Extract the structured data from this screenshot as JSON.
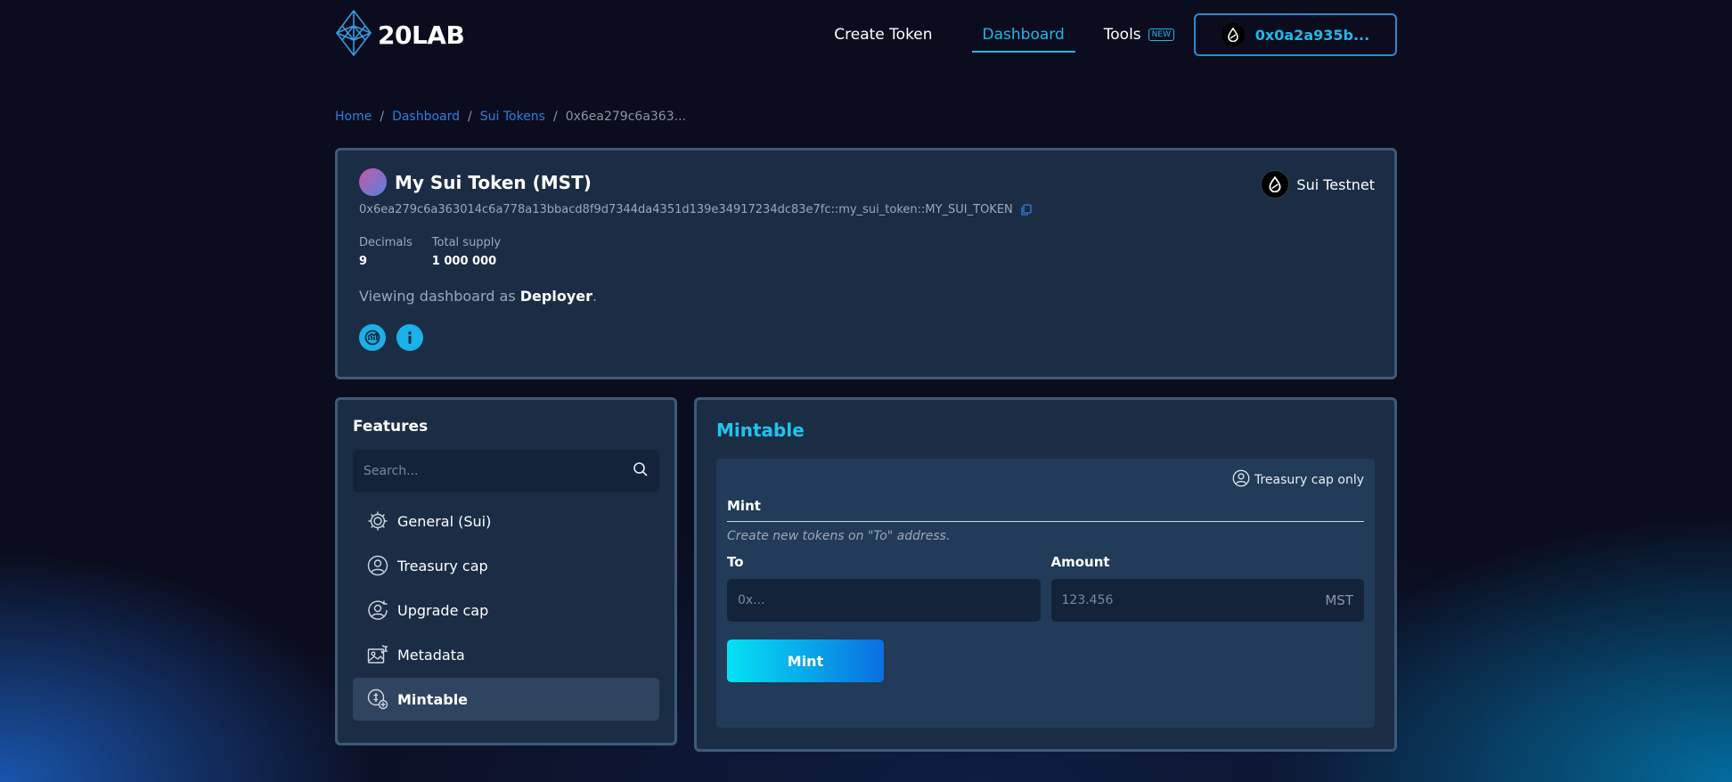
{
  "brand": {
    "logo_text": "20LAB"
  },
  "nav": {
    "create_token": "Create Token",
    "dashboard": "Dashboard",
    "tools": "Tools",
    "tools_badge": "NEW",
    "wallet": "0x0a2a935b..."
  },
  "breadcrumb": {
    "home": "Home",
    "dashboard": "Dashboard",
    "sui_tokens": "Sui Tokens",
    "current": "0x6ea279c6a363..."
  },
  "token": {
    "name": "My Sui Token (MST)",
    "network": "Sui Testnet",
    "address": "0x6ea279c6a363014c6a778a13bbacd8f9d7344da4351d139e34917234dc83e7fc::my_sui_token::MY_SUI_TOKEN",
    "decimals_label": "Decimals",
    "decimals_value": "9",
    "supply_label": "Total supply",
    "supply_value": "1 000 000",
    "viewing_prefix": "Viewing dashboard as ",
    "viewing_role": "Deployer",
    "viewing_suffix": "."
  },
  "features": {
    "title": "Features",
    "search_placeholder": "Search...",
    "items": [
      {
        "label": "General (Sui)",
        "icon": "gear-icon"
      },
      {
        "label": "Treasury cap",
        "icon": "user-circle-icon"
      },
      {
        "label": "Upgrade cap",
        "icon": "user-refresh-icon"
      },
      {
        "label": "Metadata",
        "icon": "image-edit-icon"
      },
      {
        "label": "Mintable",
        "icon": "coin-add-icon"
      }
    ],
    "active_index": 4
  },
  "mintable": {
    "title": "Mintable",
    "access_note": "Treasury cap only",
    "section_label": "Mint",
    "description": "Create new tokens on \"To\" address.",
    "to_label": "To",
    "to_placeholder": "0x...",
    "amount_label": "Amount",
    "amount_placeholder": "123.456",
    "amount_suffix": "MST",
    "button_label": "Mint"
  },
  "colors": {
    "accent": "#22b8e6",
    "link": "#2f7fdc",
    "panel": "#1b2d45",
    "background": "#0b0c1d"
  }
}
